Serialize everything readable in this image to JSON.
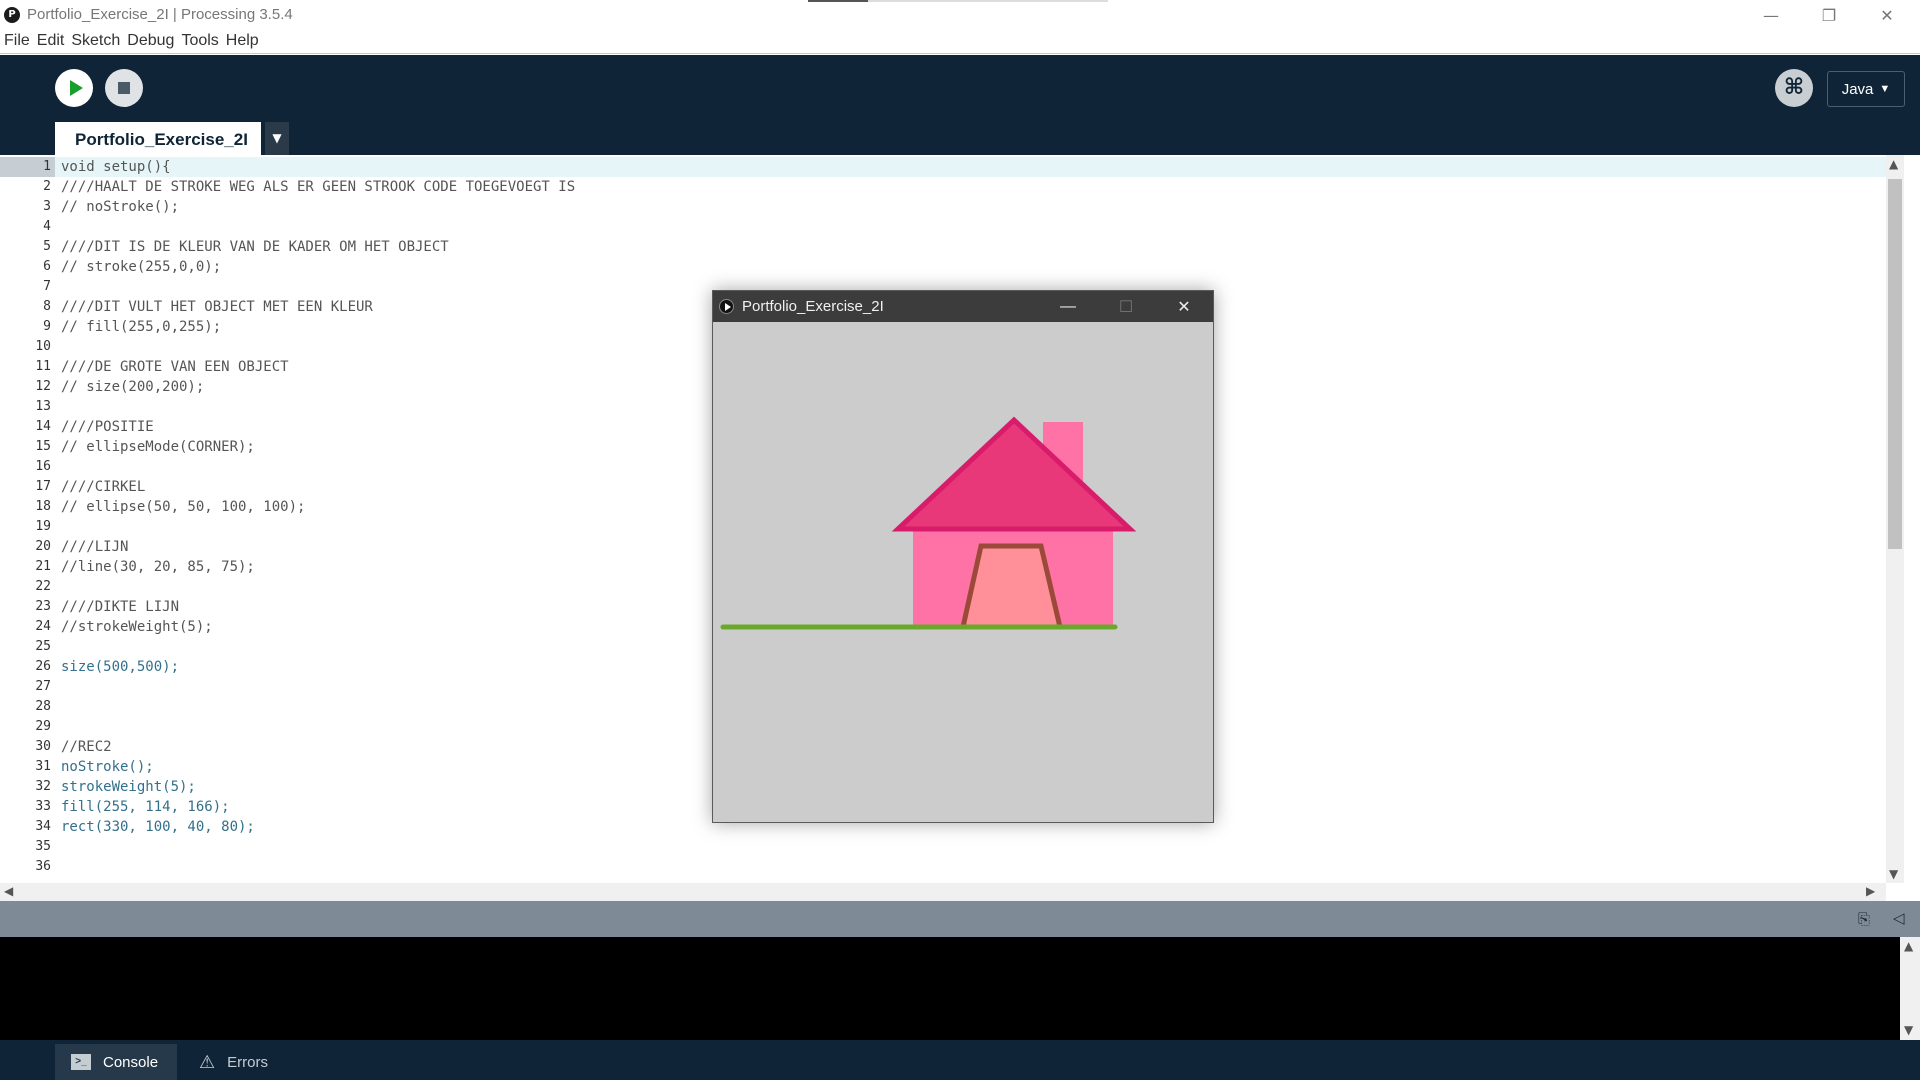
{
  "window": {
    "title": "Portfolio_Exercise_2I | Processing 3.5.4",
    "app_icon": "P",
    "controls": {
      "minimize": "—",
      "restore": "❐",
      "close": "✕"
    }
  },
  "menu": [
    "File",
    "Edit",
    "Sketch",
    "Debug",
    "Tools",
    "Help"
  ],
  "toolbar": {
    "run_icon": "play-icon",
    "stop_icon": "stop-icon",
    "debug_icon": "debugger-icon",
    "mode_label": "Java",
    "mode_arrow": "▼"
  },
  "tab": {
    "label": "Portfolio_Exercise_2I",
    "menu_arrow": "▼"
  },
  "code_lines": [
    {
      "n": "1",
      "t": "void setup(){",
      "kw": false
    },
    {
      "n": "2",
      "t": "////HAALT DE STROKE WEG ALS ER GEEN STROOK CODE TOEGEVOEGT IS",
      "kw": false
    },
    {
      "n": "3",
      "t": "// noStroke();",
      "kw": false
    },
    {
      "n": "4",
      "t": "",
      "kw": false
    },
    {
      "n": "5",
      "t": "////DIT IS DE KLEUR VAN DE KADER OM HET OBJECT",
      "kw": false
    },
    {
      "n": "6",
      "t": "// stroke(255,0,0);",
      "kw": false
    },
    {
      "n": "7",
      "t": "",
      "kw": false
    },
    {
      "n": "8",
      "t": "////DIT VULT HET OBJECT MET EEN KLEUR",
      "kw": false
    },
    {
      "n": "9",
      "t": "// fill(255,0,255);",
      "kw": false
    },
    {
      "n": "10",
      "t": "",
      "kw": false
    },
    {
      "n": "11",
      "t": "////DE GROTE VAN EEN OBJECT",
      "kw": false
    },
    {
      "n": "12",
      "t": "// size(200,200);",
      "kw": false
    },
    {
      "n": "13",
      "t": "",
      "kw": false
    },
    {
      "n": "14",
      "t": "////POSITIE",
      "kw": false
    },
    {
      "n": "15",
      "t": "// ellipseMode(CORNER);",
      "kw": false
    },
    {
      "n": "16",
      "t": "",
      "kw": false
    },
    {
      "n": "17",
      "t": "////CIRKEL",
      "kw": false
    },
    {
      "n": "18",
      "t": "// ellipse(50, 50, 100, 100);",
      "kw": false
    },
    {
      "n": "19",
      "t": "",
      "kw": false
    },
    {
      "n": "20",
      "t": "////LIJN",
      "kw": false
    },
    {
      "n": "21",
      "t": "//line(30, 20, 85, 75);",
      "kw": false
    },
    {
      "n": "22",
      "t": "",
      "kw": false
    },
    {
      "n": "23",
      "t": "////DIKTE LIJN",
      "kw": false
    },
    {
      "n": "24",
      "t": "//strokeWeight(5);",
      "kw": false
    },
    {
      "n": "25",
      "t": "",
      "kw": false
    },
    {
      "n": "26",
      "t": "size(500,500);",
      "kw": true
    },
    {
      "n": "27",
      "t": "",
      "kw": false
    },
    {
      "n": "28",
      "t": "",
      "kw": false
    },
    {
      "n": "29",
      "t": "",
      "kw": false
    },
    {
      "n": "30",
      "t": "//REC2",
      "kw": false
    },
    {
      "n": "31",
      "t": "noStroke();",
      "kw": true
    },
    {
      "n": "32",
      "t": "strokeWeight(5);",
      "kw": true
    },
    {
      "n": "33",
      "t": "fill(255, 114, 166);",
      "kw": true
    },
    {
      "n": "34",
      "t": "rect(330, 100, 40, 80);",
      "kw": true
    },
    {
      "n": "35",
      "t": "",
      "kw": false
    },
    {
      "n": "36",
      "t": "",
      "kw": false
    }
  ],
  "sketch_window": {
    "title": "Portfolio_Exercise_2I",
    "controls": {
      "minimize": "—",
      "maximize": "☐",
      "close": "✕"
    },
    "background": "#cccccc",
    "house": {
      "chimney_fill": "#ff72a6",
      "roof_fill": "#e8387a",
      "roof_stroke": "#d81b6a",
      "wall_fill": "#ff72a6",
      "door_fill": "#ff9099",
      "door_stroke": "#9b4a3a",
      "ground_stroke": "#6aa82c"
    }
  },
  "console": {
    "tabs": [
      {
        "label": "Console",
        "icon": "console-icon"
      },
      {
        "label": "Errors",
        "icon": "warning-icon"
      }
    ]
  },
  "colors": {
    "toolbar_bg": "#0f2436",
    "keyword": "#33708c",
    "comment": "#555555",
    "line_highlight": "#e6f6f8"
  }
}
